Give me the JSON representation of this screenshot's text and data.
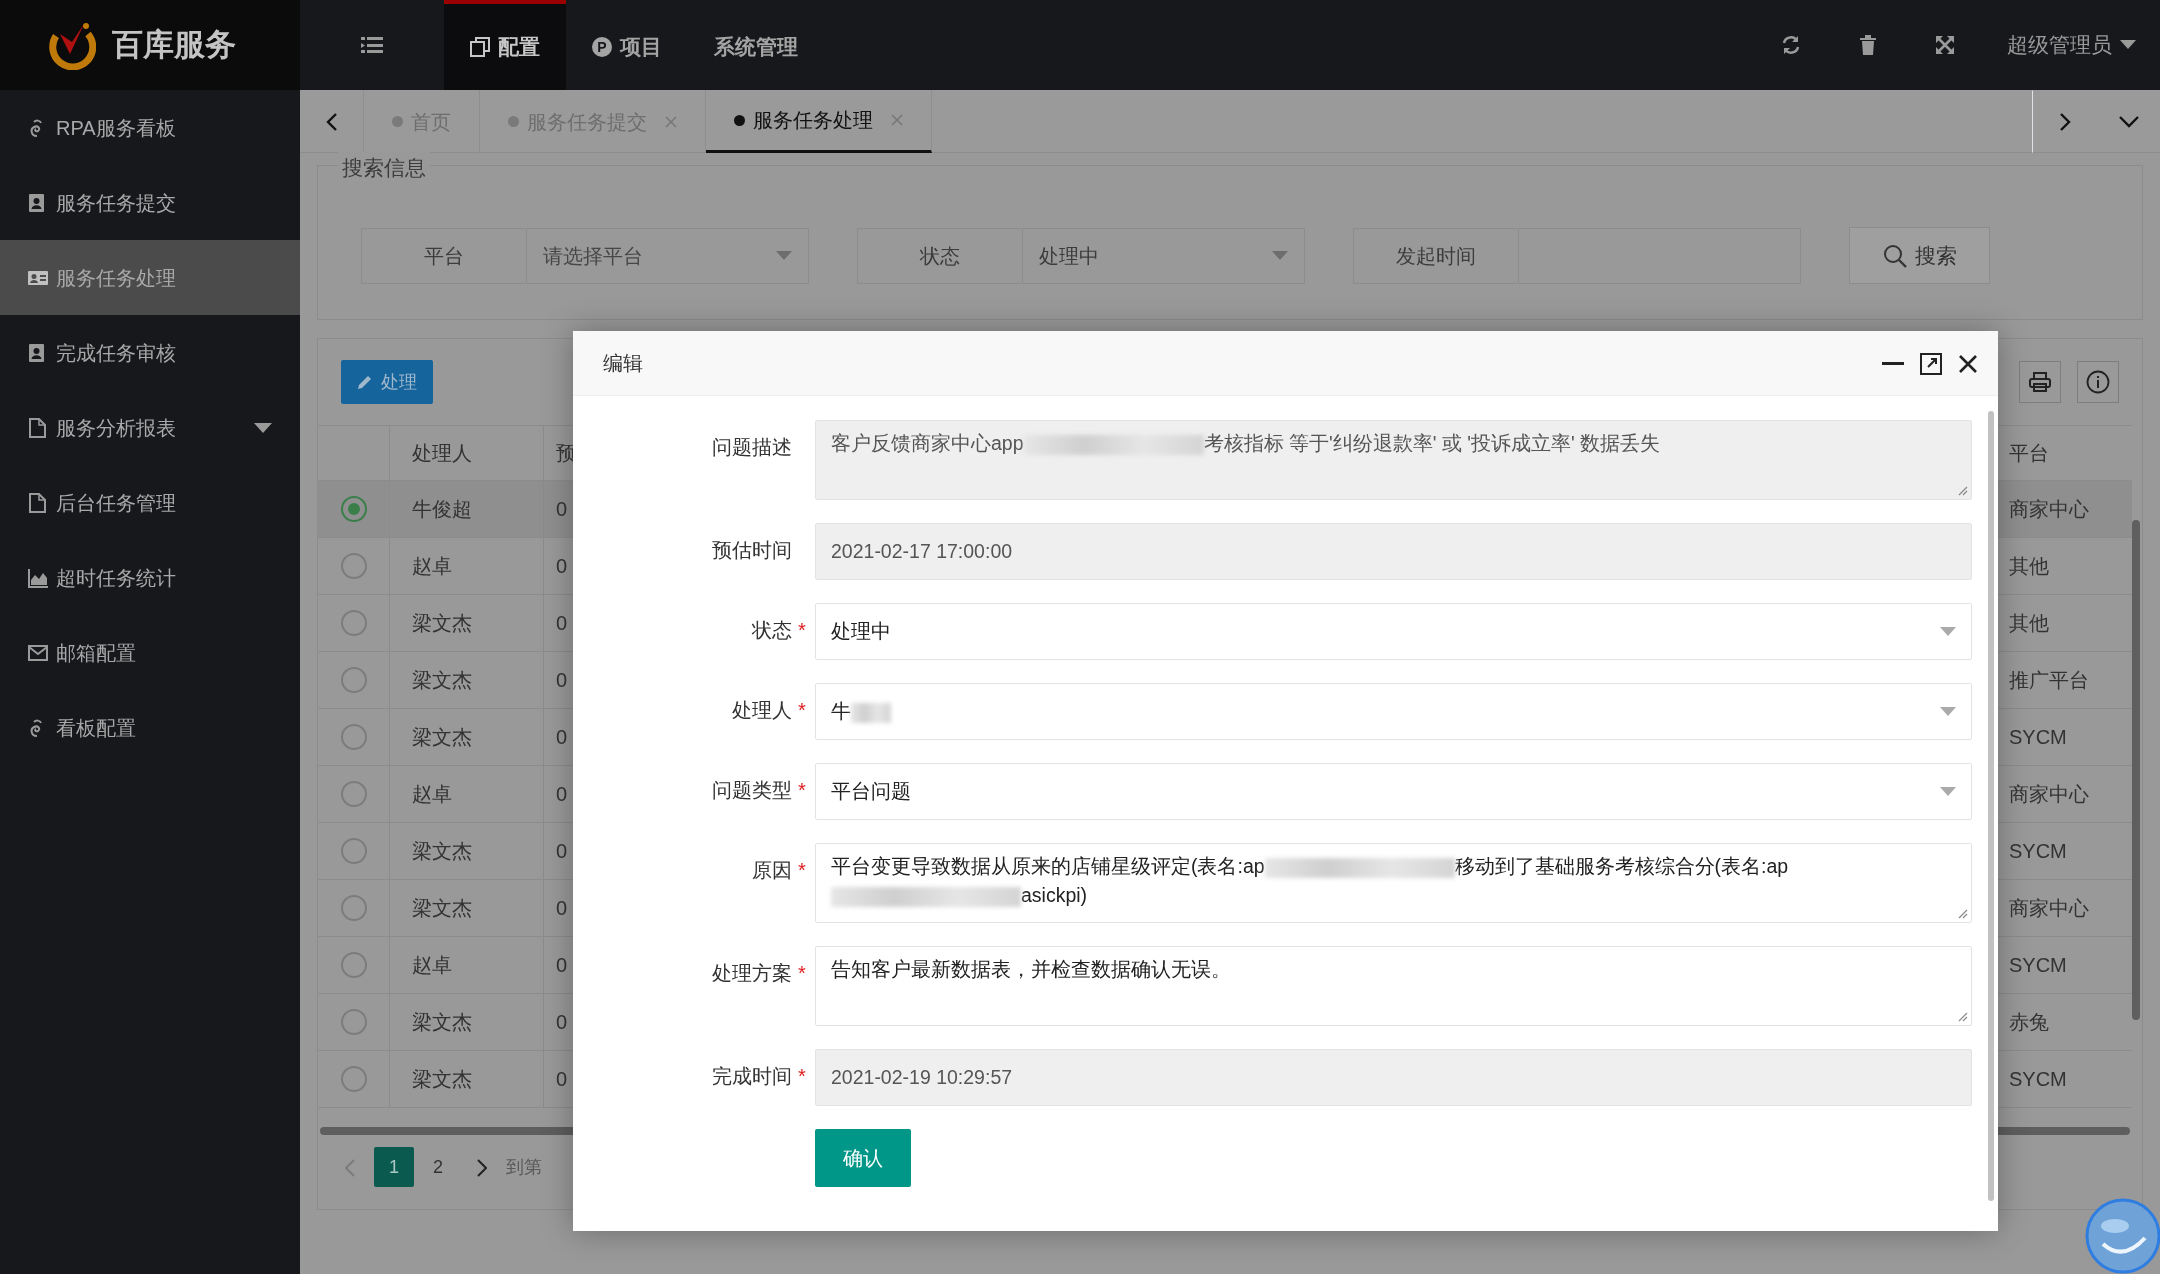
{
  "brand": {
    "name": "百库服务"
  },
  "top_nav": [
    {
      "label": "配置",
      "selected": true
    },
    {
      "label": "项目",
      "badge": "P",
      "selected": false
    },
    {
      "label": "系统管理",
      "selected": false
    }
  ],
  "user": {
    "label": "超级管理员"
  },
  "sidebar": {
    "items": [
      {
        "label": "RPA服务看板",
        "kind": "link",
        "selected": false
      },
      {
        "label": "服务任务提交",
        "kind": "link",
        "selected": false
      },
      {
        "label": "服务任务处理",
        "kind": "link",
        "selected": true
      },
      {
        "label": "完成任务审核",
        "kind": "link",
        "selected": false
      },
      {
        "label": "服务分析报表",
        "kind": "group",
        "expanded": false,
        "selected": false
      },
      {
        "label": "后台任务管理",
        "kind": "link",
        "selected": false
      },
      {
        "label": "超时任务统计",
        "kind": "link",
        "selected": false
      },
      {
        "label": "邮箱配置",
        "kind": "link",
        "selected": false
      },
      {
        "label": "看板配置",
        "kind": "link",
        "selected": false
      }
    ]
  },
  "tabs": [
    {
      "label": "首页",
      "closable": false,
      "selected": false
    },
    {
      "label": "服务任务提交",
      "closable": true,
      "selected": false
    },
    {
      "label": "服务任务处理",
      "closable": true,
      "selected": true
    }
  ],
  "search": {
    "legend": "搜索信息",
    "fields": [
      {
        "label": "平台",
        "kind": "select",
        "placeholder": "请选择平台"
      },
      {
        "label": "状态",
        "kind": "select",
        "value": "处理中"
      },
      {
        "label": "发起时间",
        "kind": "input"
      }
    ],
    "button": "搜索"
  },
  "toolbar": {
    "button": "处理"
  },
  "table": {
    "columns": [
      "处理人",
      "预",
      "平台"
    ],
    "rows": [
      {
        "selected": true,
        "handler": "牛俊超",
        "column_3": "0",
        "platform": "商家中心"
      },
      {
        "selected": false,
        "handler": "赵卓",
        "column_3": "0",
        "platform": "其他"
      },
      {
        "selected": false,
        "handler": "梁文杰",
        "column_3": "0",
        "platform": "其他"
      },
      {
        "selected": false,
        "handler": "梁文杰",
        "column_3": "0",
        "platform": "推广平台"
      },
      {
        "selected": false,
        "handler": "梁文杰",
        "column_3": "0",
        "platform": "SYCM"
      },
      {
        "selected": false,
        "handler": "赵卓",
        "column_3": "0",
        "platform": "商家中心"
      },
      {
        "selected": false,
        "handler": "梁文杰",
        "column_3": "0",
        "platform": "SYCM"
      },
      {
        "selected": false,
        "handler": "梁文杰",
        "column_3": "0",
        "platform": "商家中心"
      },
      {
        "selected": false,
        "handler": "赵卓",
        "column_3": "0",
        "platform": "SYCM"
      },
      {
        "selected": false,
        "handler": "梁文杰",
        "column_3": "0",
        "platform": "赤兔"
      },
      {
        "selected": false,
        "handler": "梁文杰",
        "column_3": "0",
        "platform": "SYCM"
      }
    ]
  },
  "pagination": {
    "prev": {
      "disabled": true
    },
    "pages": [
      {
        "label": "1",
        "selected": true
      },
      {
        "label": "2",
        "selected": false
      }
    ],
    "next": {
      "disabled": false
    },
    "goto_label": "到第"
  },
  "modal": {
    "title": "编辑",
    "submit": "确认",
    "required_mark": "*",
    "fields": [
      {
        "label": "问题描述",
        "kind": "textarea",
        "required": false,
        "readonly": true,
        "parts": [
          {
            "kind": "text",
            "text": "客户反馈商家中心app"
          },
          {
            "kind": "blur"
          },
          {
            "kind": "text",
            "text": "考核指标 等于'纠纷退款率' 或 '投诉成立率' 数据丢失"
          }
        ]
      },
      {
        "label": "预估时间",
        "kind": "input",
        "required": false,
        "readonly": true,
        "parts": [
          {
            "kind": "text",
            "text": "2021-02-17 17:00:00"
          }
        ]
      },
      {
        "label": "状态",
        "kind": "select",
        "required": true,
        "readonly": false,
        "parts": [
          {
            "kind": "text",
            "text": "处理中"
          }
        ]
      },
      {
        "label": "处理人",
        "kind": "select",
        "required": true,
        "readonly": false,
        "parts": [
          {
            "kind": "text",
            "text": "牛"
          },
          {
            "kind": "blur"
          }
        ]
      },
      {
        "label": "问题类型",
        "kind": "select",
        "required": true,
        "readonly": false,
        "parts": [
          {
            "kind": "text",
            "text": "平台问题"
          }
        ]
      },
      {
        "label": "原因",
        "kind": "textarea",
        "required": true,
        "readonly": false,
        "parts": [
          {
            "kind": "text",
            "text": "平台变更导致数据从原来的店铺星级评定(表名:ap"
          },
          {
            "kind": "blur"
          },
          {
            "kind": "text",
            "text": "移动到了基础服务考核综合分(表名:ap"
          },
          {
            "kind": "blur"
          },
          {
            "kind": "text",
            "text": "asickpi)"
          }
        ]
      },
      {
        "label": "处理方案",
        "kind": "textarea",
        "required": true,
        "readonly": false,
        "parts": [
          {
            "kind": "text",
            "text": "告知客户最新数据表，并检查数据确认无误。"
          }
        ]
      },
      {
        "label": "完成时间",
        "kind": "input",
        "required": true,
        "readonly": true,
        "parts": [
          {
            "kind": "text",
            "text": "2021-02-19 10:29:57"
          }
        ]
      }
    ]
  }
}
